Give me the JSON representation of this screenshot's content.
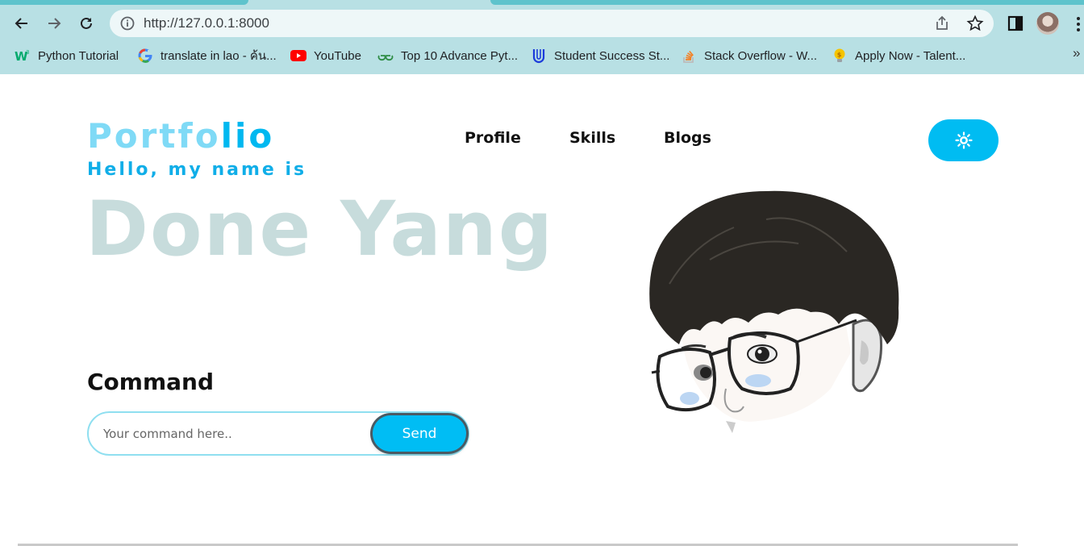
{
  "browser": {
    "url": "http://127.0.0.1:8000",
    "bookmarks": [
      {
        "label": "Python Tutorial",
        "icon": "w3schools-icon",
        "color": "#04aa6d"
      },
      {
        "label": "translate in lao - ค้น...",
        "icon": "google-icon",
        "color": "#4285f4"
      },
      {
        "label": "YouTube",
        "icon": "youtube-icon",
        "color": "#ff0000"
      },
      {
        "label": "Top 10 Advance Pyt...",
        "icon": "geeksforgeeks-icon",
        "color": "#2f8d46"
      },
      {
        "label": "Student Success St...",
        "icon": "udacity-icon",
        "color": "#1c3cdb"
      },
      {
        "label": "Stack Overflow - W...",
        "icon": "stackoverflow-icon",
        "color": "#f48024"
      },
      {
        "label": "Apply Now - Talent...",
        "icon": "lightbulb-icon",
        "color": "#f5c400"
      }
    ],
    "more_label": "»"
  },
  "site": {
    "logo_main": "Portfo",
    "logo_accent": "lio",
    "nav": [
      "Profile",
      "Skills",
      "Blogs"
    ],
    "theme_toggle_icon": "sun-icon",
    "greeting": "Hello, my name is",
    "name": "Done Yang",
    "command": {
      "title": "Command",
      "placeholder": "Your command here..",
      "value": "",
      "send_label": "Send"
    },
    "portrait_icon": "cartoon-portrait-illustration"
  },
  "colors": {
    "accent": "#00bcf2",
    "logo_light": "#7fdaf6",
    "name_gray": "#c7dcdc",
    "chrome_bg": "#b8e0e4"
  }
}
